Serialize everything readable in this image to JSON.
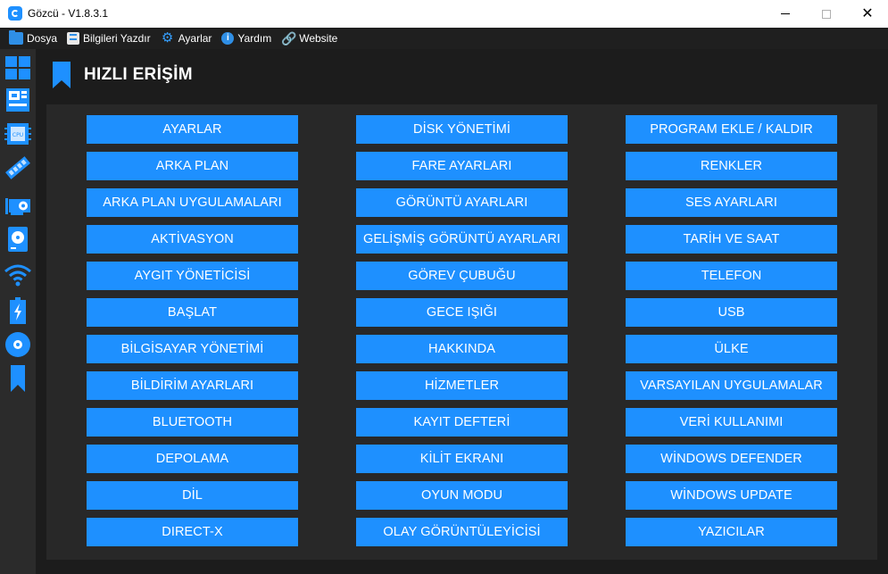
{
  "window": {
    "title": "Gözcü - V1.8.3.1",
    "close_glyph": "✕"
  },
  "menu": [
    {
      "label": "Dosya",
      "icon": "folder-icon"
    },
    {
      "label": "Bilgileri Yazdır",
      "icon": "print-icon"
    },
    {
      "label": "Ayarlar",
      "icon": "gear-icon"
    },
    {
      "label": "Yardım",
      "icon": "info-icon"
    },
    {
      "label": "Website",
      "icon": "link-icon"
    }
  ],
  "sidebar": [
    {
      "icon": "windows-icon"
    },
    {
      "icon": "motherboard-icon"
    },
    {
      "icon": "cpu-icon"
    },
    {
      "icon": "ram-icon"
    },
    {
      "icon": "gpu-icon"
    },
    {
      "icon": "disk-icon"
    },
    {
      "icon": "wifi-icon"
    },
    {
      "icon": "battery-icon"
    },
    {
      "icon": "optical-drive-icon"
    },
    {
      "icon": "bookmark-icon"
    }
  ],
  "cpu_chip_text": "CPU",
  "page_title": "HIZLI ERİŞİM",
  "accent_color": "#1e90ff",
  "quick_access": {
    "column_1": [
      "AYARLAR",
      "ARKA PLAN",
      "ARKA PLAN UYGULAMALARI",
      "AKTİVASYON",
      "AYGIT YÖNETİCİSİ",
      "BAŞLAT",
      "BİLGİSAYAR YÖNETİMİ",
      "BİLDİRİM AYARLARI",
      "BLUETOOTH",
      "DEPOLAMA",
      "DİL",
      "DIRECT-X"
    ],
    "column_2": [
      "DİSK YÖNETİMİ",
      "FARE AYARLARI",
      "GÖRÜNTÜ AYARLARI",
      "GELİŞMİŞ GÖRÜNTÜ AYARLARI",
      "GÖREV ÇUBUĞU",
      "GECE IŞIĞI",
      "HAKKINDA",
      "HİZMETLER",
      "KAYIT DEFTERİ",
      "KİLİT EKRANI",
      "OYUN MODU",
      "OLAY GÖRÜNTÜLEYİCİSİ"
    ],
    "column_3": [
      "PROGRAM EKLE / KALDIR",
      "RENKLER",
      "SES AYARLARI",
      "TARİH VE SAAT",
      "TELEFON",
      "USB",
      "ÜLKE",
      "VARSAYILAN UYGULAMALAR",
      "VERİ KULLANIMI",
      "WİNDOWS DEFENDER",
      "WİNDOWS UPDATE",
      "YAZICILAR"
    ]
  }
}
